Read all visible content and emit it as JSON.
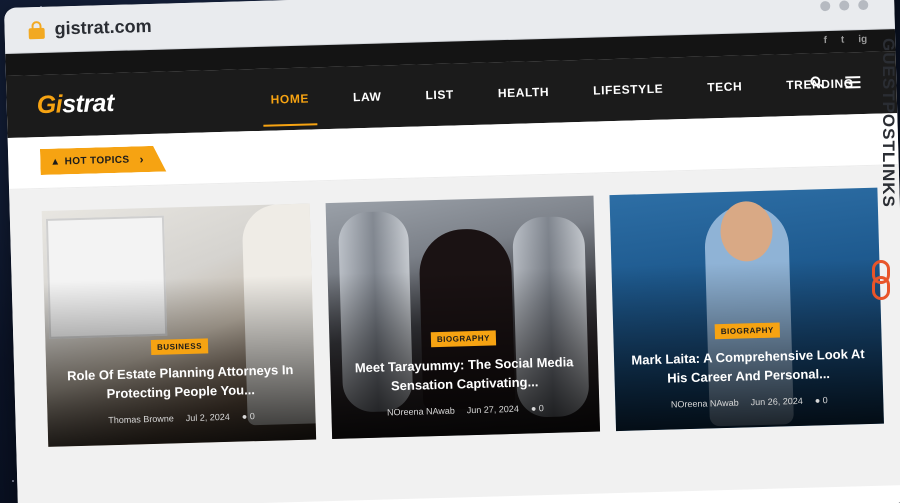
{
  "browser": {
    "url": "gistrat.com"
  },
  "social": [
    "f",
    "t",
    "ig"
  ],
  "logo": {
    "g": "Gi",
    "rest": "strat"
  },
  "menu": [
    "HOME",
    "LAW",
    "LIST",
    "HEALTH",
    "LIFESTYLE",
    "TECH",
    "TRENDING"
  ],
  "hot_topics": {
    "label": "HOT TOPICS"
  },
  "cards": [
    {
      "category": "BUSINESS",
      "title": "Role Of Estate Planning Attorneys In Protecting People You...",
      "author": "Thomas Browne",
      "date": "Jul 2, 2024",
      "comments": "0"
    },
    {
      "category": "BIOGRAPHY",
      "title": "Meet Tarayummy: The Social Media Sensation Captivating...",
      "author": "NOreena NAwab",
      "date": "Jun 27, 2024",
      "comments": "0"
    },
    {
      "category": "BIOGRAPHY",
      "title": "Mark Laita: A Comprehensive Look At His Career And Personal...",
      "author": "NOreena NAwab",
      "date": "Jun 26, 2024",
      "comments": "0"
    }
  ],
  "watermark": {
    "text": "GUESTPOSTLINKS"
  },
  "colors": {
    "accent": "#f6a312",
    "nav_bg": "#1b1b1b",
    "watermark_accent": "#e8552a"
  }
}
